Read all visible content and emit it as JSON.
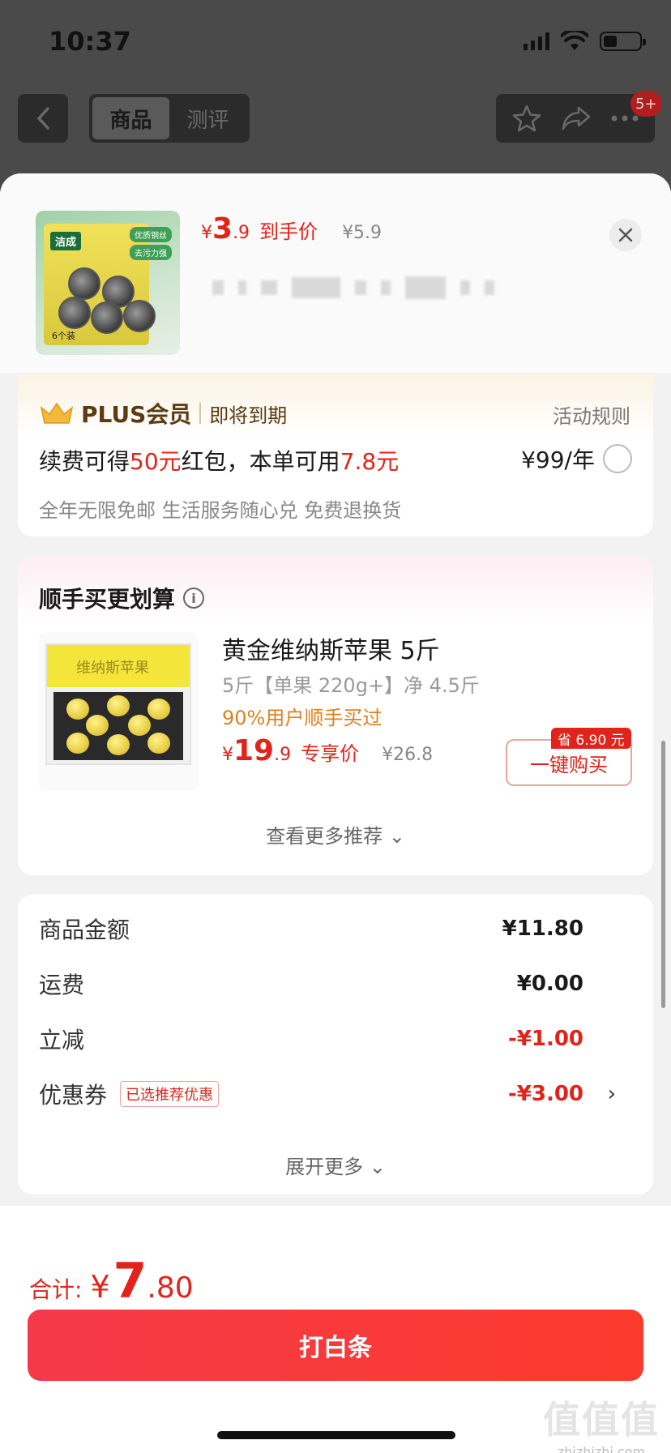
{
  "status_bar": {
    "time": "10:37"
  },
  "nav": {
    "tabs": [
      {
        "label": "商品",
        "active": true
      },
      {
        "label": "测评",
        "active": false
      }
    ],
    "badge": "5+"
  },
  "product": {
    "price_symbol": "¥",
    "price_int": "3",
    "price_dec": ".9",
    "price_label": "到手价",
    "original_price": "¥5.9",
    "image_texts": {
      "brand": "洁成",
      "tag1": "优质钢丝",
      "tag2": "去污力强",
      "count": "6个装"
    }
  },
  "plus": {
    "name": "PLUS会员",
    "status": "即将到期",
    "rules": "活动规则",
    "line_prefix": "续费可得",
    "bonus": "50元",
    "line_middle": "红包，本单可用",
    "usable": "7.8元",
    "price": "¥99/年",
    "benefits": "全年无限免邮 生活服务随心兑 免费退换货"
  },
  "recommend": {
    "title": "顺手买更划算",
    "item": {
      "name": "黄金维纳斯苹果 5斤",
      "spec": "5斤【单果 220g+】净 4.5斤",
      "bought": "90%用户顺手买过",
      "price_symbol": "¥",
      "price_int": "19",
      "price_dec": ".9",
      "price_label": "专享价",
      "original_price": "¥26.8",
      "save_badge": "省 6.90 元",
      "buy_label": "一键购买",
      "box_text": "维纳斯苹果"
    },
    "more_label": "查看更多推荐 ⌄"
  },
  "summary": {
    "rows": [
      {
        "label": "商品金额",
        "value": "¥11.80"
      },
      {
        "label": "运费",
        "value": "¥0.00"
      },
      {
        "label": "立减",
        "value": "-¥1.00"
      },
      {
        "label": "优惠券",
        "value": "-¥3.00",
        "tag": "已选推荐优惠"
      }
    ],
    "expand_label": "展开更多 ⌄"
  },
  "footer": {
    "total_label": "合计:",
    "total_symbol": "¥",
    "total_int": "7",
    "total_dec": ".80",
    "pay_label": "打白条",
    "watermark_main": "值值值",
    "watermark_sub": "zhizhizhi.com"
  },
  "colors": {
    "accent": "#e2231a",
    "plus_gold": "#5c3a12",
    "bought_orange": "#e0801f"
  }
}
